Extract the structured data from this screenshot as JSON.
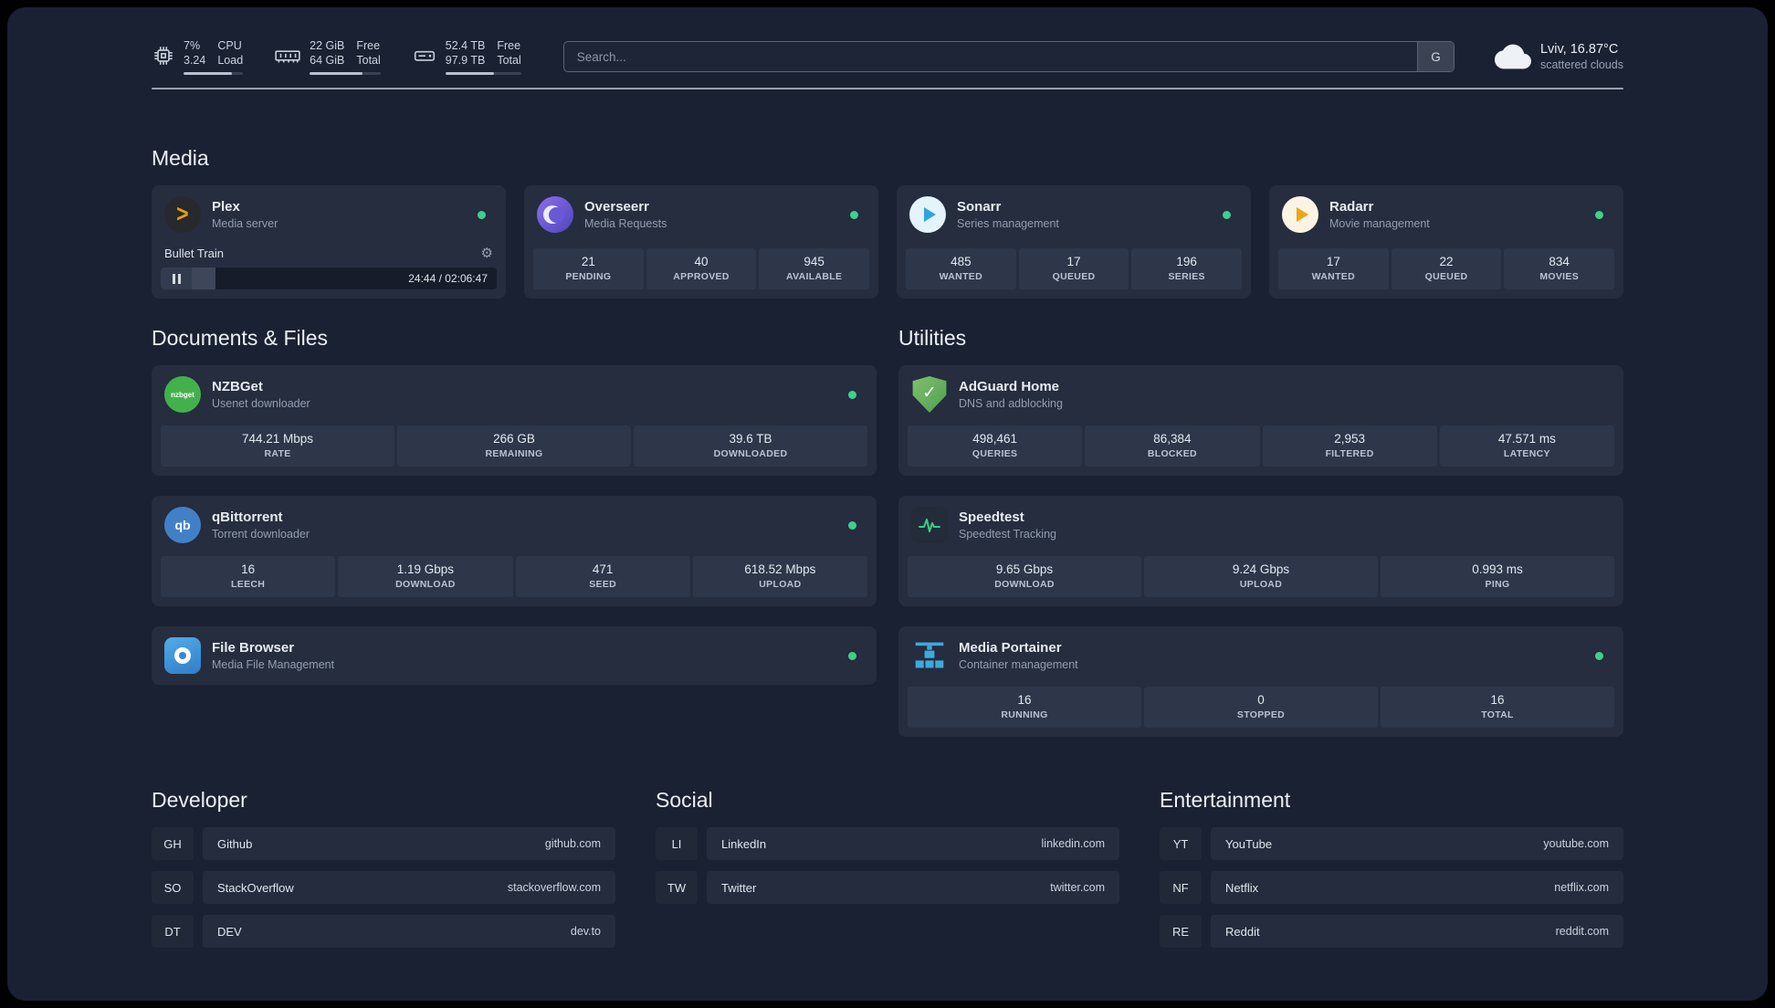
{
  "colors": {
    "accent_green": "#3fd08c",
    "background": "#1a2132"
  },
  "topbar": {
    "resources": [
      {
        "values": [
          "7%",
          "3.24"
        ],
        "labels": [
          "CPU",
          "Load"
        ],
        "progress": 82
      },
      {
        "values": [
          "22 GiB",
          "64 GiB"
        ],
        "labels": [
          "Free",
          "Total"
        ],
        "progress": 74
      },
      {
        "values": [
          "52.4 TB",
          "97.9 TB"
        ],
        "labels": [
          "Free",
          "Total"
        ],
        "progress": 64
      }
    ],
    "search": {
      "placeholder": "Search...",
      "provider": "G"
    },
    "weather": {
      "location": "Lviv, 16.87°C",
      "condition": "scattered clouds"
    }
  },
  "media": {
    "title": "Media",
    "plex": {
      "name": "Plex",
      "subtitle": "Media server",
      "track": "Bullet Train",
      "time": "24:44 / 02:06:47",
      "progress": 7
    },
    "overseerr": {
      "name": "Overseerr",
      "subtitle": "Media Requests",
      "stats": [
        {
          "value": "21",
          "label": "PENDING"
        },
        {
          "value": "40",
          "label": "APPROVED"
        },
        {
          "value": "945",
          "label": "AVAILABLE"
        }
      ]
    },
    "sonarr": {
      "name": "Sonarr",
      "subtitle": "Series management",
      "stats": [
        {
          "value": "485",
          "label": "WANTED"
        },
        {
          "value": "17",
          "label": "QUEUED"
        },
        {
          "value": "196",
          "label": "SERIES"
        }
      ]
    },
    "radarr": {
      "name": "Radarr",
      "subtitle": "Movie management",
      "stats": [
        {
          "value": "17",
          "label": "WANTED"
        },
        {
          "value": "22",
          "label": "QUEUED"
        },
        {
          "value": "834",
          "label": "MOVIES"
        }
      ]
    }
  },
  "documents": {
    "title": "Documents & Files",
    "nzbget": {
      "name": "NZBGet",
      "subtitle": "Usenet downloader",
      "icon_text": "nzbget",
      "stats": [
        {
          "value": "744.21 Mbps",
          "label": "RATE"
        },
        {
          "value": "266 GB",
          "label": "REMAINING"
        },
        {
          "value": "39.6 TB",
          "label": "DOWNLOADED"
        }
      ]
    },
    "qbittorrent": {
      "name": "qBittorrent",
      "subtitle": "Torrent downloader",
      "icon_text": "qb",
      "stats": [
        {
          "value": "16",
          "label": "LEECH"
        },
        {
          "value": "1.19 Gbps",
          "label": "DOWNLOAD"
        },
        {
          "value": "471",
          "label": "SEED"
        },
        {
          "value": "618.52 Mbps",
          "label": "UPLOAD"
        }
      ]
    },
    "filebrowser": {
      "name": "File Browser",
      "subtitle": "Media File Management"
    }
  },
  "utilities": {
    "title": "Utilities",
    "adguard": {
      "name": "AdGuard Home",
      "subtitle": "DNS and adblocking",
      "stats": [
        {
          "value": "498,461",
          "label": "QUERIES"
        },
        {
          "value": "86,384",
          "label": "BLOCKED"
        },
        {
          "value": "2,953",
          "label": "FILTERED"
        },
        {
          "value": "47.571 ms",
          "label": "LATENCY"
        }
      ]
    },
    "speedtest": {
      "name": "Speedtest",
      "subtitle": "Speedtest Tracking",
      "stats": [
        {
          "value": "9.65 Gbps",
          "label": "DOWNLOAD"
        },
        {
          "value": "9.24 Gbps",
          "label": "UPLOAD"
        },
        {
          "value": "0.993 ms",
          "label": "PING"
        }
      ]
    },
    "portainer": {
      "name": "Media Portainer",
      "subtitle": "Container management",
      "stats": [
        {
          "value": "16",
          "label": "RUNNING"
        },
        {
          "value": "0",
          "label": "STOPPED"
        },
        {
          "value": "16",
          "label": "TOTAL"
        }
      ]
    }
  },
  "bookmarks": {
    "developer": {
      "title": "Developer",
      "items": [
        {
          "abbr": "GH",
          "name": "Github",
          "url": "github.com"
        },
        {
          "abbr": "SO",
          "name": "StackOverflow",
          "url": "stackoverflow.com"
        },
        {
          "abbr": "DT",
          "name": "DEV",
          "url": "dev.to"
        }
      ]
    },
    "social": {
      "title": "Social",
      "items": [
        {
          "abbr": "LI",
          "name": "LinkedIn",
          "url": "linkedin.com"
        },
        {
          "abbr": "TW",
          "name": "Twitter",
          "url": "twitter.com"
        }
      ]
    },
    "entertainment": {
      "title": "Entertainment",
      "items": [
        {
          "abbr": "YT",
          "name": "YouTube",
          "url": "youtube.com"
        },
        {
          "abbr": "NF",
          "name": "Netflix",
          "url": "netflix.com"
        },
        {
          "abbr": "RE",
          "name": "Reddit",
          "url": "reddit.com"
        }
      ]
    }
  }
}
